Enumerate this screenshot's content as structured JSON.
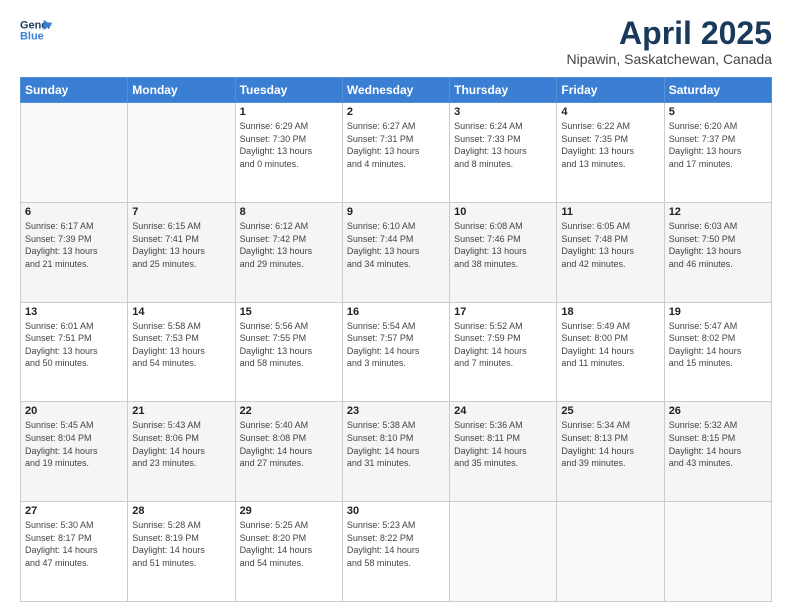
{
  "header": {
    "logo_line1": "General",
    "logo_line2": "Blue",
    "title": "April 2025",
    "subtitle": "Nipawin, Saskatchewan, Canada"
  },
  "weekdays": [
    "Sunday",
    "Monday",
    "Tuesday",
    "Wednesday",
    "Thursday",
    "Friday",
    "Saturday"
  ],
  "weeks": [
    [
      {
        "day": "",
        "detail": ""
      },
      {
        "day": "",
        "detail": ""
      },
      {
        "day": "1",
        "detail": "Sunrise: 6:29 AM\nSunset: 7:30 PM\nDaylight: 13 hours\nand 0 minutes."
      },
      {
        "day": "2",
        "detail": "Sunrise: 6:27 AM\nSunset: 7:31 PM\nDaylight: 13 hours\nand 4 minutes."
      },
      {
        "day": "3",
        "detail": "Sunrise: 6:24 AM\nSunset: 7:33 PM\nDaylight: 13 hours\nand 8 minutes."
      },
      {
        "day": "4",
        "detail": "Sunrise: 6:22 AM\nSunset: 7:35 PM\nDaylight: 13 hours\nand 13 minutes."
      },
      {
        "day": "5",
        "detail": "Sunrise: 6:20 AM\nSunset: 7:37 PM\nDaylight: 13 hours\nand 17 minutes."
      }
    ],
    [
      {
        "day": "6",
        "detail": "Sunrise: 6:17 AM\nSunset: 7:39 PM\nDaylight: 13 hours\nand 21 minutes."
      },
      {
        "day": "7",
        "detail": "Sunrise: 6:15 AM\nSunset: 7:41 PM\nDaylight: 13 hours\nand 25 minutes."
      },
      {
        "day": "8",
        "detail": "Sunrise: 6:12 AM\nSunset: 7:42 PM\nDaylight: 13 hours\nand 29 minutes."
      },
      {
        "day": "9",
        "detail": "Sunrise: 6:10 AM\nSunset: 7:44 PM\nDaylight: 13 hours\nand 34 minutes."
      },
      {
        "day": "10",
        "detail": "Sunrise: 6:08 AM\nSunset: 7:46 PM\nDaylight: 13 hours\nand 38 minutes."
      },
      {
        "day": "11",
        "detail": "Sunrise: 6:05 AM\nSunset: 7:48 PM\nDaylight: 13 hours\nand 42 minutes."
      },
      {
        "day": "12",
        "detail": "Sunrise: 6:03 AM\nSunset: 7:50 PM\nDaylight: 13 hours\nand 46 minutes."
      }
    ],
    [
      {
        "day": "13",
        "detail": "Sunrise: 6:01 AM\nSunset: 7:51 PM\nDaylight: 13 hours\nand 50 minutes."
      },
      {
        "day": "14",
        "detail": "Sunrise: 5:58 AM\nSunset: 7:53 PM\nDaylight: 13 hours\nand 54 minutes."
      },
      {
        "day": "15",
        "detail": "Sunrise: 5:56 AM\nSunset: 7:55 PM\nDaylight: 13 hours\nand 58 minutes."
      },
      {
        "day": "16",
        "detail": "Sunrise: 5:54 AM\nSunset: 7:57 PM\nDaylight: 14 hours\nand 3 minutes."
      },
      {
        "day": "17",
        "detail": "Sunrise: 5:52 AM\nSunset: 7:59 PM\nDaylight: 14 hours\nand 7 minutes."
      },
      {
        "day": "18",
        "detail": "Sunrise: 5:49 AM\nSunset: 8:00 PM\nDaylight: 14 hours\nand 11 minutes."
      },
      {
        "day": "19",
        "detail": "Sunrise: 5:47 AM\nSunset: 8:02 PM\nDaylight: 14 hours\nand 15 minutes."
      }
    ],
    [
      {
        "day": "20",
        "detail": "Sunrise: 5:45 AM\nSunset: 8:04 PM\nDaylight: 14 hours\nand 19 minutes."
      },
      {
        "day": "21",
        "detail": "Sunrise: 5:43 AM\nSunset: 8:06 PM\nDaylight: 14 hours\nand 23 minutes."
      },
      {
        "day": "22",
        "detail": "Sunrise: 5:40 AM\nSunset: 8:08 PM\nDaylight: 14 hours\nand 27 minutes."
      },
      {
        "day": "23",
        "detail": "Sunrise: 5:38 AM\nSunset: 8:10 PM\nDaylight: 14 hours\nand 31 minutes."
      },
      {
        "day": "24",
        "detail": "Sunrise: 5:36 AM\nSunset: 8:11 PM\nDaylight: 14 hours\nand 35 minutes."
      },
      {
        "day": "25",
        "detail": "Sunrise: 5:34 AM\nSunset: 8:13 PM\nDaylight: 14 hours\nand 39 minutes."
      },
      {
        "day": "26",
        "detail": "Sunrise: 5:32 AM\nSunset: 8:15 PM\nDaylight: 14 hours\nand 43 minutes."
      }
    ],
    [
      {
        "day": "27",
        "detail": "Sunrise: 5:30 AM\nSunset: 8:17 PM\nDaylight: 14 hours\nand 47 minutes."
      },
      {
        "day": "28",
        "detail": "Sunrise: 5:28 AM\nSunset: 8:19 PM\nDaylight: 14 hours\nand 51 minutes."
      },
      {
        "day": "29",
        "detail": "Sunrise: 5:25 AM\nSunset: 8:20 PM\nDaylight: 14 hours\nand 54 minutes."
      },
      {
        "day": "30",
        "detail": "Sunrise: 5:23 AM\nSunset: 8:22 PM\nDaylight: 14 hours\nand 58 minutes."
      },
      {
        "day": "",
        "detail": ""
      },
      {
        "day": "",
        "detail": ""
      },
      {
        "day": "",
        "detail": ""
      }
    ]
  ]
}
